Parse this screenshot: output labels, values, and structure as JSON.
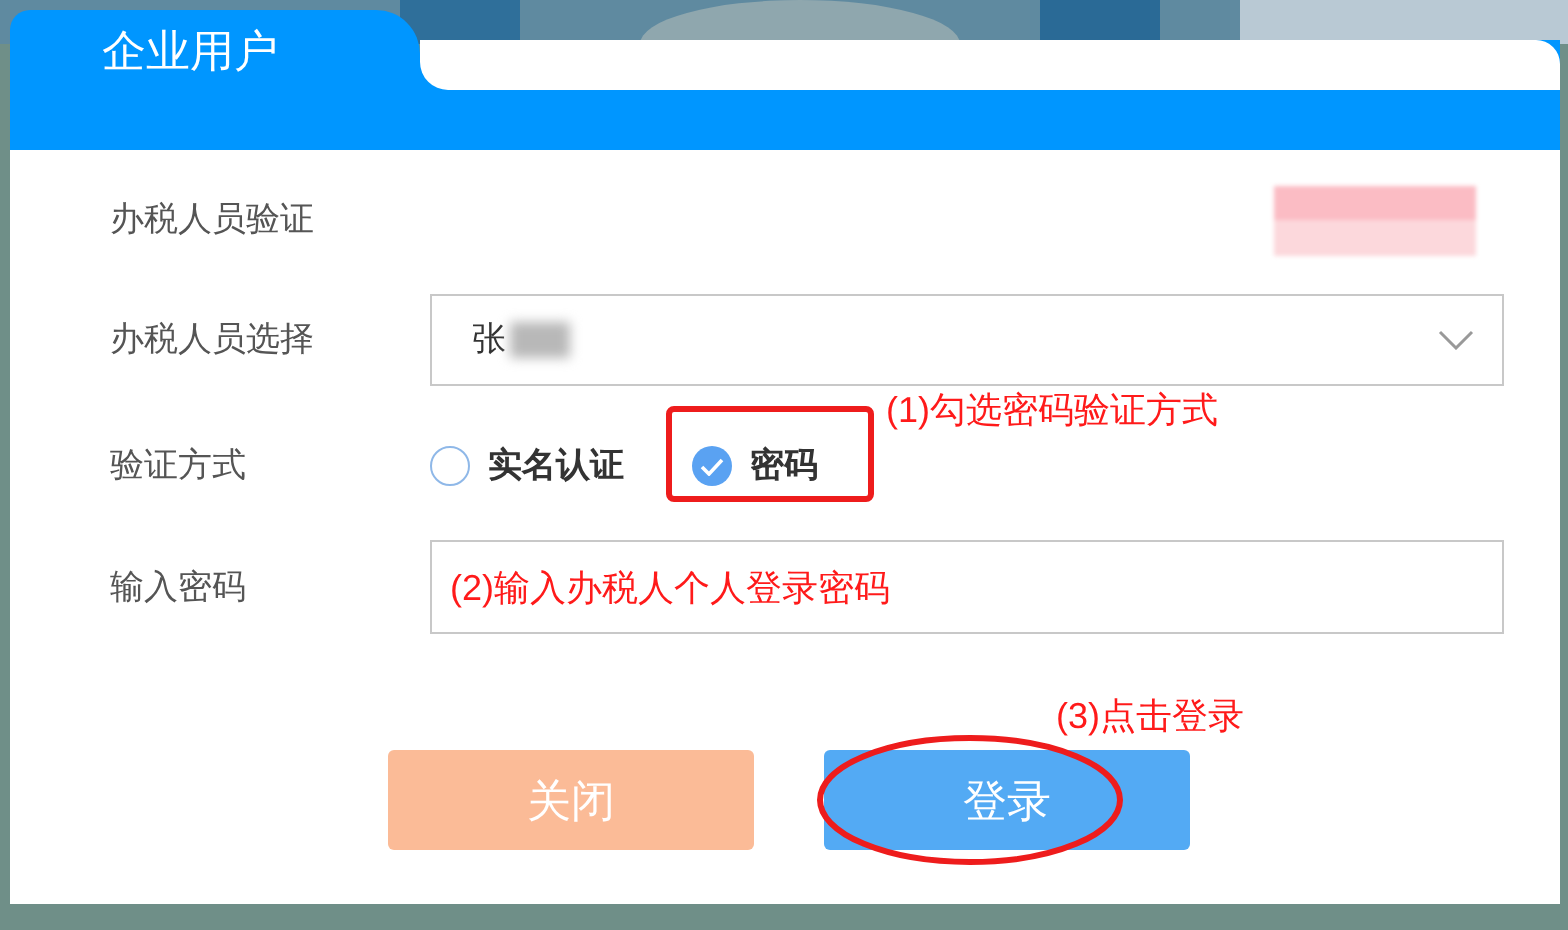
{
  "dialog": {
    "tab": "企业用户",
    "fields": [
      {
        "kind": "info",
        "label": "办税人员验证"
      },
      {
        "kind": "select",
        "label": "办税人员选择",
        "value": "张"
      },
      {
        "kind": "radio",
        "label": "验证方式",
        "options": [
          {
            "label": "实名认证",
            "selected": false
          },
          {
            "label": "密码",
            "selected": true
          }
        ]
      },
      {
        "kind": "input",
        "label": "输入密码"
      }
    ],
    "buttons": [
      {
        "label": "关闭",
        "kind": "secondary"
      },
      {
        "label": "登录",
        "kind": "primary"
      }
    ]
  },
  "annotations": [
    "(1)勾选密码验证方式",
    "(2)输入办税人个人登录密码",
    "(3)点击登录"
  ]
}
